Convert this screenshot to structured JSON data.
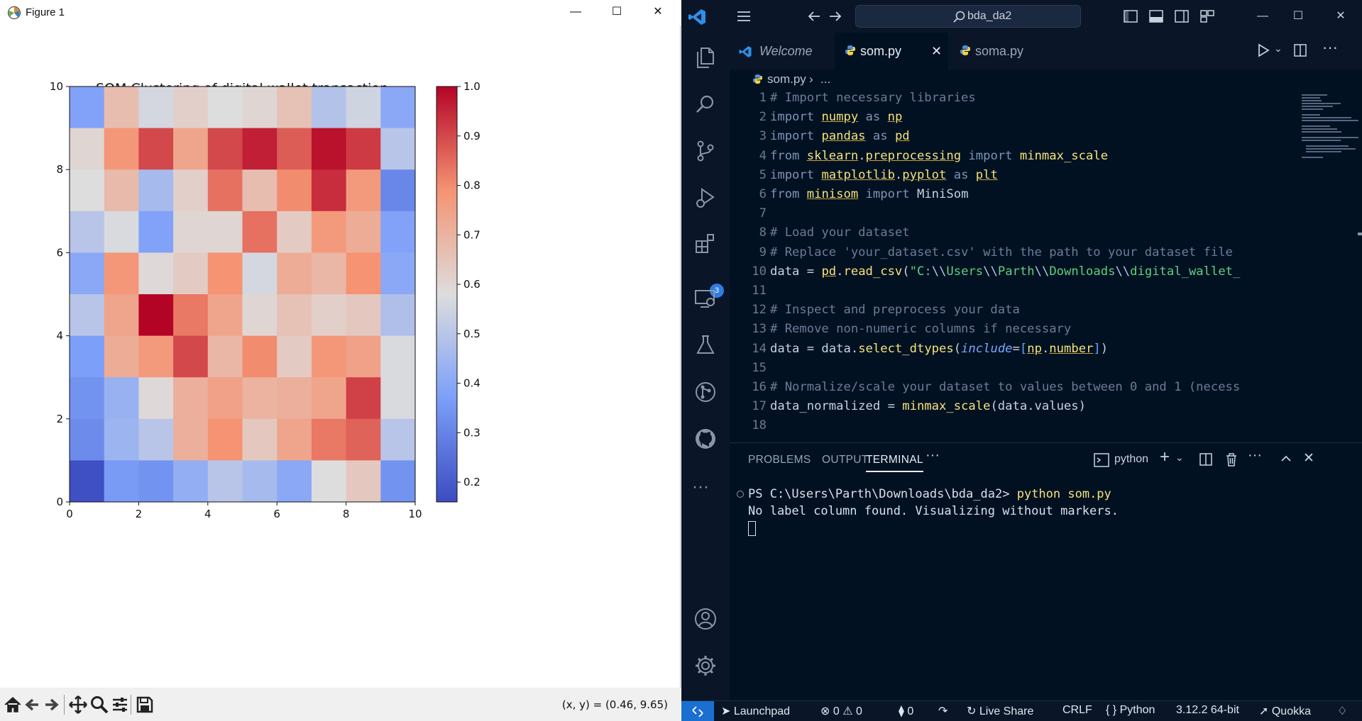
{
  "figure_window": {
    "title": "Figure 1",
    "coord_readout": "(x, y) = (0.46, 9.65)",
    "toolbar_icons": [
      "home-icon",
      "back-arrow-icon",
      "forward-arrow-icon",
      "pan-icon",
      "zoom-icon",
      "configure-subplots-icon",
      "save-icon"
    ]
  },
  "chart_data": {
    "type": "heatmap",
    "title": "SOM Clustering of digital wallet transaction",
    "xlim": [
      0,
      10
    ],
    "ylim": [
      0,
      10
    ],
    "xticks": [
      "0",
      "2",
      "4",
      "6",
      "8",
      "10"
    ],
    "yticks": [
      "0",
      "2",
      "4",
      "6",
      "8",
      "10"
    ],
    "colormap": "coolwarm",
    "colorbar_range": [
      0.16,
      1.0
    ],
    "colorbar_ticks": [
      "0.2",
      "0.3",
      "0.4",
      "0.5",
      "0.6",
      "0.7",
      "0.8",
      "0.9",
      "1.0"
    ],
    "cells_top_to_bottom": [
      [
        0.38,
        0.67,
        0.56,
        0.62,
        0.58,
        0.6,
        0.66,
        0.49,
        0.55,
        0.4
      ],
      [
        0.6,
        0.78,
        0.9,
        0.74,
        0.9,
        0.96,
        0.87,
        0.98,
        0.92,
        0.5
      ],
      [
        0.58,
        0.68,
        0.46,
        0.62,
        0.84,
        0.67,
        0.8,
        0.94,
        0.77,
        0.31
      ],
      [
        0.5,
        0.57,
        0.38,
        0.6,
        0.6,
        0.84,
        0.63,
        0.77,
        0.72,
        0.38
      ],
      [
        0.4,
        0.78,
        0.59,
        0.63,
        0.79,
        0.56,
        0.72,
        0.69,
        0.79,
        0.4
      ],
      [
        0.5,
        0.74,
        1.0,
        0.83,
        0.74,
        0.6,
        0.66,
        0.62,
        0.64,
        0.48
      ],
      [
        0.37,
        0.72,
        0.77,
        0.9,
        0.69,
        0.8,
        0.63,
        0.78,
        0.75,
        0.57
      ],
      [
        0.34,
        0.43,
        0.59,
        0.71,
        0.75,
        0.7,
        0.71,
        0.74,
        0.91,
        0.57
      ],
      [
        0.32,
        0.44,
        0.5,
        0.71,
        0.79,
        0.64,
        0.74,
        0.83,
        0.86,
        0.5
      ],
      [
        0.17,
        0.36,
        0.34,
        0.42,
        0.5,
        0.46,
        0.4,
        0.58,
        0.64,
        0.34
      ]
    ]
  },
  "vscode": {
    "command_center": "bda_da2",
    "tabs": [
      {
        "label": "Welcome",
        "active": false
      },
      {
        "label": "som.py",
        "active": true
      },
      {
        "label": "soma.py",
        "active": false
      }
    ],
    "breadcrumb": {
      "file": "som.py",
      "rest": "..."
    },
    "extensions_badge": "3",
    "code_lines": [
      {
        "n": "1",
        "tokens": [
          [
            "c-com",
            "# Import necessary libraries"
          ]
        ]
      },
      {
        "n": "2",
        "tokens": [
          [
            "c-kw",
            "import "
          ],
          [
            "c-mod",
            "numpy"
          ],
          [
            "c-kw",
            " as "
          ],
          [
            "c-mod",
            "np"
          ]
        ]
      },
      {
        "n": "3",
        "tokens": [
          [
            "c-kw",
            "import "
          ],
          [
            "c-mod",
            "pandas"
          ],
          [
            "c-kw",
            " as "
          ],
          [
            "c-mod",
            "pd"
          ]
        ]
      },
      {
        "n": "4",
        "tokens": [
          [
            "c-kw",
            "from "
          ],
          [
            "c-mod",
            "sklearn"
          ],
          [
            "c-var",
            "."
          ],
          [
            "c-mod",
            "preprocessing"
          ],
          [
            "c-kw",
            " import "
          ],
          [
            "c-fn",
            "minmax_scale"
          ]
        ]
      },
      {
        "n": "5",
        "tokens": [
          [
            "c-kw",
            "import "
          ],
          [
            "c-mod",
            "matplotlib"
          ],
          [
            "c-var",
            "."
          ],
          [
            "c-mod",
            "pyplot"
          ],
          [
            "c-kw",
            " as "
          ],
          [
            "c-mod",
            "plt"
          ]
        ]
      },
      {
        "n": "6",
        "tokens": [
          [
            "c-kw",
            "from "
          ],
          [
            "c-mod",
            "minisom"
          ],
          [
            "c-kw",
            " import "
          ],
          [
            "c-var",
            "MiniSom"
          ]
        ]
      },
      {
        "n": "7",
        "tokens": []
      },
      {
        "n": "8",
        "tokens": [
          [
            "c-com",
            "# Load your dataset"
          ]
        ]
      },
      {
        "n": "9",
        "tokens": [
          [
            "c-com",
            "# Replace 'your_dataset.csv' with the path to your dataset file"
          ]
        ]
      },
      {
        "n": "10",
        "tokens": [
          [
            "c-var",
            "data = "
          ],
          [
            "c-mod",
            "pd"
          ],
          [
            "c-var",
            "."
          ],
          [
            "c-fn",
            "read_csv"
          ],
          [
            "c-var",
            "("
          ],
          [
            "c-str",
            "\"C:"
          ],
          [
            "c-esc",
            "\\\\"
          ],
          [
            "c-str",
            "Users"
          ],
          [
            "c-esc",
            "\\\\"
          ],
          [
            "c-str",
            "Parth"
          ],
          [
            "c-esc",
            "\\\\"
          ],
          [
            "c-str",
            "Downloads"
          ],
          [
            "c-esc",
            "\\\\"
          ],
          [
            "c-str",
            "digital_wallet_"
          ]
        ]
      },
      {
        "n": "11",
        "tokens": []
      },
      {
        "n": "12",
        "tokens": [
          [
            "c-com",
            "# Inspect and preprocess your data"
          ]
        ]
      },
      {
        "n": "13",
        "tokens": [
          [
            "c-com",
            "# Remove non-numeric columns if necessary"
          ]
        ]
      },
      {
        "n": "14",
        "tokens": [
          [
            "c-var",
            "data = data."
          ],
          [
            "c-fn",
            "select_dtypes"
          ],
          [
            "c-var",
            "("
          ],
          [
            "c-param",
            "include"
          ],
          [
            "c-var",
            "="
          ],
          [
            "c-punc",
            "["
          ],
          [
            "c-mod",
            "np"
          ],
          [
            "c-var",
            "."
          ],
          [
            "c-mod",
            "number"
          ],
          [
            "c-punc",
            "]"
          ],
          [
            "c-var",
            ")"
          ]
        ]
      },
      {
        "n": "15",
        "tokens": []
      },
      {
        "n": "16",
        "tokens": [
          [
            "c-com",
            "# Normalize/scale your dataset to values between 0 and 1 (necess"
          ]
        ]
      },
      {
        "n": "17",
        "tokens": [
          [
            "c-var",
            "data_normalized = "
          ],
          [
            "c-fn",
            "minmax_scale"
          ],
          [
            "c-var",
            "(data.values)"
          ]
        ]
      },
      {
        "n": "18",
        "tokens": []
      }
    ],
    "panel": {
      "tabs": [
        "PROBLEMS",
        "OUTPUT",
        "TERMINAL"
      ],
      "active_tab": "TERMINAL",
      "shell_label": "python",
      "prompt": "PS C:\\Users\\Parth\\Downloads\\bda_da2>",
      "command": "python som.py",
      "output": "No label column found. Visualizing without markers."
    },
    "status": {
      "launchpad": "Launchpad",
      "errors": "0",
      "warnings": "0",
      "ports": "0",
      "live_share": "Live Share",
      "eol": "CRLF",
      "language": "Python",
      "interpreter": "3.12.2 64-bit",
      "quokka": "Quokka"
    },
    "colors": {
      "accent": "#1b6fd0",
      "background": "#011122"
    }
  }
}
